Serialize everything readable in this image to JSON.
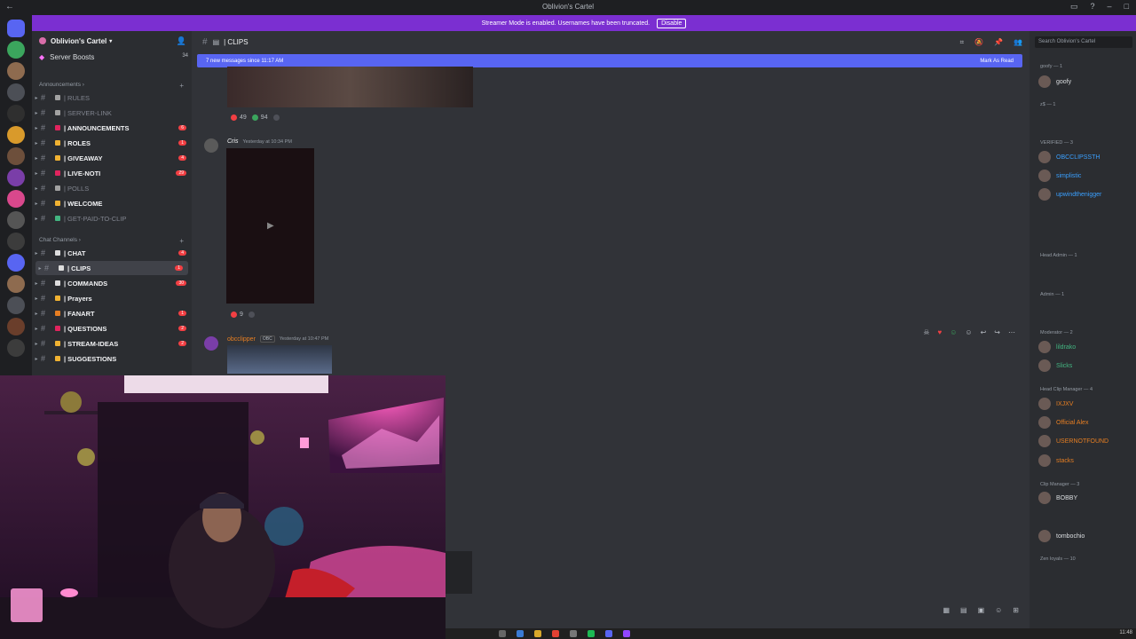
{
  "window": {
    "title": "Oblivion's Cartel"
  },
  "banner": {
    "text": "Streamer Mode is enabled. Usernames have been truncated.",
    "button": "Disable"
  },
  "guild": {
    "name": "Oblivion's Cartel",
    "boosts_label": "Server Boosts",
    "boosts_count": "34"
  },
  "categories": {
    "announcements": "Announcements",
    "chat": "Chat Channels"
  },
  "channels": [
    {
      "name": "| RULES",
      "muted": true,
      "count": ""
    },
    {
      "name": "| SERVER-LINK",
      "muted": true,
      "count": ""
    },
    {
      "name": "| ANNOUNCEMENTS",
      "muted": false,
      "count": "6"
    },
    {
      "name": "| ROLES",
      "muted": false,
      "count": "1"
    },
    {
      "name": "| GIVEAWAY",
      "muted": false,
      "count": "4"
    },
    {
      "name": "| LIVE-NOTI",
      "muted": false,
      "count": "29"
    },
    {
      "name": "| POLLS",
      "muted": true,
      "count": ""
    },
    {
      "name": "| WELCOME",
      "muted": false,
      "count": ""
    },
    {
      "name": "| GET-PAID-TO-CLIP",
      "muted": true,
      "count": ""
    },
    {
      "name": "| CHAT",
      "muted": false,
      "count": "4"
    },
    {
      "name": "| CLIPS",
      "muted": false,
      "count": "1"
    },
    {
      "name": "| COMMANDS",
      "muted": false,
      "count": "30"
    },
    {
      "name": "| Prayers",
      "muted": false,
      "count": ""
    },
    {
      "name": "| FANART",
      "muted": false,
      "count": "1"
    },
    {
      "name": "| QUESTIONS",
      "muted": false,
      "count": "2"
    },
    {
      "name": "| STREAM-IDEAS",
      "muted": false,
      "count": "2"
    },
    {
      "name": "| SUGGESTIONS",
      "muted": false,
      "count": ""
    }
  ],
  "main": {
    "channel_title": "| CLIPS",
    "new_messages": "7 new messages since 11:17 AM",
    "mark_read": "Mark As Read",
    "r1_a": "49",
    "r1_b": "94",
    "msg2_author": "Cris",
    "msg2_time": "Yesterday at 10:34 PM",
    "r2_a": "9",
    "msg3_author": "obcclipper",
    "msg3_tag": "OBC",
    "msg3_time": "Yesterday at 10:47 PM"
  },
  "members": {
    "search_placeholder": "Search Oblivion's Cartel",
    "sections": [
      {
        "label": "goofy — 1"
      },
      {
        "label": "z$ — 1"
      },
      {
        "label": "VERIFIED — 3"
      },
      {
        "label": "Head Admin — 1"
      },
      {
        "label": "Admin — 1"
      },
      {
        "label": "Moderator — 2"
      },
      {
        "label": "Head Clip Manager — 4"
      },
      {
        "label": "Clip Manager — 3"
      },
      {
        "label": "Zen loyals — 10"
      }
    ],
    "list": [
      {
        "name": "goofy",
        "color": "#dbdee1"
      },
      {
        "name": "OBCCLIPSSTH",
        "color": "#3aa0ff"
      },
      {
        "name": "simplistic",
        "color": "#3aa0ff"
      },
      {
        "name": "upwindthenigger",
        "color": "#3aa0ff"
      },
      {
        "name": "lildrako",
        "color": "#43b581"
      },
      {
        "name": "Slicks",
        "color": "#43b581"
      },
      {
        "name": "IXJXV",
        "color": "#e67e22"
      },
      {
        "name": "Official Alex",
        "color": "#e67e22"
      },
      {
        "name": "USERNOTFOUND",
        "color": "#e67e22"
      },
      {
        "name": "stacks",
        "color": "#e67e22"
      },
      {
        "name": "BOBBY",
        "color": "#dbdee1"
      },
      {
        "name": "tombochio",
        "color": "#dbdee1"
      }
    ]
  },
  "taskbar": {
    "clock": "11:48"
  }
}
